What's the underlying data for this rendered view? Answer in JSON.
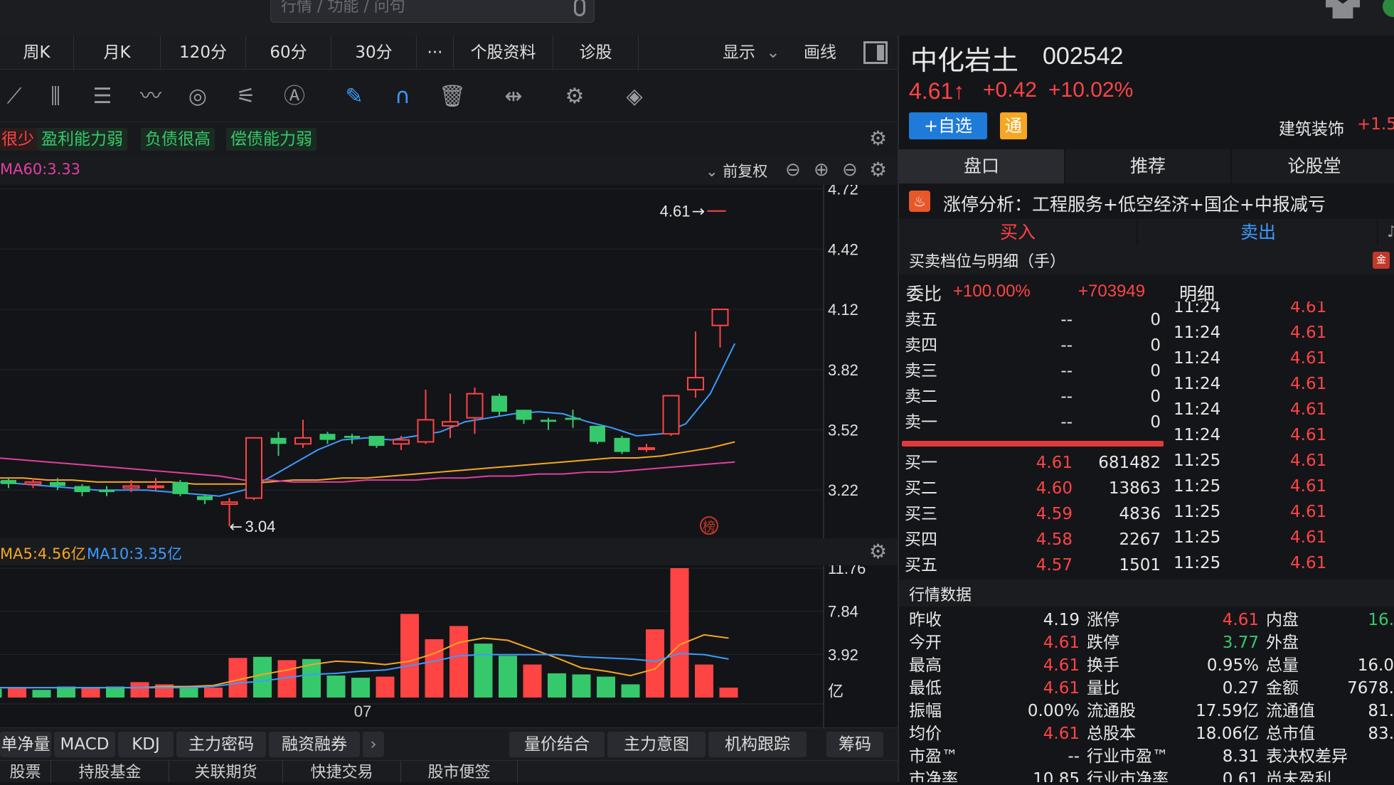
{
  "search": {
    "placeholder": "行情 / 功能 / 问句"
  },
  "period_tabs": [
    {
      "label": "周K"
    },
    {
      "label": "月K"
    },
    {
      "label": "120分"
    },
    {
      "label": "60分"
    },
    {
      "label": "30分"
    },
    {
      "label": "···"
    },
    {
      "label": "个股资料"
    },
    {
      "label": "诊股"
    }
  ],
  "display": {
    "show_label": "显示",
    "draw_label": "画线"
  },
  "tags": [
    {
      "label": "很少",
      "color": "#ff4444"
    },
    {
      "label": "盈利能力弱"
    },
    {
      "label": "负债很高"
    },
    {
      "label": "偿债能力弱"
    }
  ],
  "ma_bar": {
    "ma60": "MA60:3.33",
    "adj": "前复权"
  },
  "price_axis": {
    "ticks": [
      "4.72",
      "4.42",
      "4.12",
      "3.82",
      "3.52",
      "3.22"
    ]
  },
  "price_labels": {
    "high": "4.61",
    "low": "3.04",
    "bang": "榜"
  },
  "vol_header": {
    "ma5": "MA5:4.56亿",
    "ma10": "MA10:3.35亿"
  },
  "vol_axis": {
    "ticks": [
      "11.76",
      "7.84",
      "3.92",
      "亿"
    ]
  },
  "x_label": "07",
  "indicator_tabs": [
    {
      "label": "单净量"
    },
    {
      "label": "MACD"
    },
    {
      "label": "KDJ"
    },
    {
      "label": "主力密码"
    },
    {
      "label": "融资融券"
    }
  ],
  "analysis_tabs": [
    {
      "label": "量价结合"
    },
    {
      "label": "主力意图"
    },
    {
      "label": "机构跟踪"
    }
  ],
  "chip_label": "筹码",
  "bottom_tabs": [
    {
      "label": "股票"
    },
    {
      "label": "持股基金"
    },
    {
      "label": "关联期货"
    },
    {
      "label": "快捷交易"
    },
    {
      "label": "股市便签"
    }
  ],
  "stock": {
    "name": "中化岩土",
    "code": "002542",
    "price": "4.61↑",
    "change": "+0.42",
    "change_pct": "+10.02%",
    "add_btn": "+自选",
    "tong": "通",
    "sector": "建筑装饰",
    "sector_change": "+1.5"
  },
  "right_tabs": [
    {
      "label": "盘口"
    },
    {
      "label": "推荐"
    },
    {
      "label": "论股堂"
    }
  ],
  "limit_up": {
    "text": "涨停分析：工程服务+低空经济+国企+中报减亏"
  },
  "buy_sell": {
    "buy": "买入",
    "sell": "卖出",
    "extra": "♪"
  },
  "orderbook": {
    "title": "买卖档位与明细（手）",
    "webi_label": "委比",
    "webi": "+100.00%",
    "weicha": "+703949",
    "mingxi": "明细",
    "sell": [
      {
        "label": "卖五",
        "price": "--",
        "vol": "0"
      },
      {
        "label": "卖四",
        "price": "--",
        "vol": "0"
      },
      {
        "label": "卖三",
        "price": "--",
        "vol": "0"
      },
      {
        "label": "卖二",
        "price": "--",
        "vol": "0"
      },
      {
        "label": "卖一",
        "price": "--",
        "vol": "0"
      }
    ],
    "buy": [
      {
        "label": "买一",
        "price": "4.61",
        "vol": "681482"
      },
      {
        "label": "买二",
        "price": "4.60",
        "vol": "13863"
      },
      {
        "label": "买三",
        "price": "4.59",
        "vol": "4836"
      },
      {
        "label": "买四",
        "price": "4.58",
        "vol": "2267"
      },
      {
        "label": "买五",
        "price": "4.57",
        "vol": "1501"
      }
    ]
  },
  "ticks": [
    {
      "time": "11:24",
      "price": "4.61"
    },
    {
      "time": "11:24",
      "price": "4.61"
    },
    {
      "time": "11:24",
      "price": "4.61"
    },
    {
      "time": "11:24",
      "price": "4.61"
    },
    {
      "time": "11:24",
      "price": "4.61"
    },
    {
      "time": "11:24",
      "price": "4.61"
    },
    {
      "time": "11:25",
      "price": "4.61"
    },
    {
      "time": "11:25",
      "price": "4.61"
    },
    {
      "time": "11:25",
      "price": "4.61"
    },
    {
      "time": "11:25",
      "price": "4.61"
    },
    {
      "time": "11:25",
      "price": "4.61"
    }
  ],
  "market": {
    "title": "行情数据",
    "rows": [
      {
        "l1": "昨收",
        "v1": "4.19",
        "c1": "#e8e8e8",
        "l2": "涨停",
        "v2": "4.61",
        "c2": "#ff4444",
        "l3": "内盘",
        "v3": "16.",
        "c3": "#35c96b"
      },
      {
        "l1": "今开",
        "v1": "4.61",
        "c1": "#ff4444",
        "l2": "跌停",
        "v2": "3.77",
        "c2": "#35c96b",
        "l3": "外盘",
        "v3": "",
        "c3": "#ff4444"
      },
      {
        "l1": "最高",
        "v1": "4.61",
        "c1": "#ff4444",
        "l2": "换手",
        "v2": "0.95%",
        "c2": "#e8e8e8",
        "l3": "总量",
        "v3": "16.0",
        "c3": "#e8e8e8"
      },
      {
        "l1": "最低",
        "v1": "4.61",
        "c1": "#ff4444",
        "l2": "量比",
        "v2": "0.27",
        "c2": "#e8e8e8",
        "l3": "金额",
        "v3": "7678.",
        "c3": "#e8e8e8"
      },
      {
        "l1": "振幅",
        "v1": "0.00%",
        "c1": "#e8e8e8",
        "l2": "流通股",
        "v2": "17.59亿",
        "c2": "#e8e8e8",
        "l3": "流通值",
        "v3": "81.",
        "c3": "#e8e8e8"
      },
      {
        "l1": "均价",
        "v1": "4.61",
        "c1": "#ff4444",
        "l2": "总股本",
        "v2": "18.06亿",
        "c2": "#e8e8e8",
        "l3": "总市值",
        "v3": "83.",
        "c3": "#e8e8e8"
      },
      {
        "l1": "市盈™",
        "v1": "--",
        "c1": "#e8e8e8",
        "l2": "行业市盈™",
        "v2": "8.31",
        "c2": "#e8e8e8",
        "l3": "表决权差异",
        "v3": "",
        "c3": "#e8e8e8"
      },
      {
        "l1": "市净率",
        "v1": "10.85",
        "c1": "#e8e8e8",
        "l2": "行业市净率",
        "v2": "0.61",
        "c2": "#e8e8e8",
        "l3": "尚未盈利",
        "v3": "",
        "c3": "#e8e8e8"
      }
    ]
  },
  "colors": {
    "up": "#ff4444",
    "down": "#35c96b",
    "ma5": "#ffffff",
    "ma10": "#3b9cff",
    "ma20": "#f5a623",
    "ma60": "#e040a0",
    "bg": "#131418"
  },
  "chart_data": {
    "type": "candlestick",
    "ylim": [
      2.98,
      4.74
    ],
    "candles": [
      {
        "o": 3.27,
        "c": 3.25,
        "h": 3.28,
        "l": 3.23
      },
      {
        "o": 3.25,
        "c": 3.26,
        "h": 3.28,
        "l": 3.23
      },
      {
        "o": 3.26,
        "c": 3.24,
        "h": 3.28,
        "l": 3.22
      },
      {
        "o": 3.24,
        "c": 3.21,
        "h": 3.25,
        "l": 3.19
      },
      {
        "o": 3.22,
        "c": 3.21,
        "h": 3.24,
        "l": 3.19
      },
      {
        "o": 3.23,
        "c": 3.24,
        "h": 3.27,
        "l": 3.21
      },
      {
        "o": 3.24,
        "c": 3.24,
        "h": 3.28,
        "l": 3.22
      },
      {
        "o": 3.26,
        "c": 3.2,
        "h": 3.27,
        "l": 3.19
      },
      {
        "o": 3.19,
        "c": 3.17,
        "h": 3.2,
        "l": 3.15
      },
      {
        "o": 3.15,
        "c": 3.16,
        "h": 3.18,
        "l": 3.04
      },
      {
        "o": 3.18,
        "c": 3.48,
        "h": 3.48,
        "l": 3.17
      },
      {
        "o": 3.48,
        "c": 3.45,
        "h": 3.51,
        "l": 3.39
      },
      {
        "o": 3.45,
        "c": 3.48,
        "h": 3.57,
        "l": 3.43
      },
      {
        "o": 3.5,
        "c": 3.47,
        "h": 3.51,
        "l": 3.45
      },
      {
        "o": 3.49,
        "c": 3.48,
        "h": 3.5,
        "l": 3.45
      },
      {
        "o": 3.49,
        "c": 3.44,
        "h": 3.49,
        "l": 3.43
      },
      {
        "o": 3.45,
        "c": 3.47,
        "h": 3.49,
        "l": 3.42
      },
      {
        "o": 3.46,
        "c": 3.57,
        "h": 3.72,
        "l": 3.45
      },
      {
        "o": 3.54,
        "c": 3.56,
        "h": 3.7,
        "l": 3.48
      },
      {
        "o": 3.58,
        "c": 3.7,
        "h": 3.73,
        "l": 3.5
      },
      {
        "o": 3.69,
        "c": 3.61,
        "h": 3.7,
        "l": 3.59
      },
      {
        "o": 3.62,
        "c": 3.57,
        "h": 3.62,
        "l": 3.55
      },
      {
        "o": 3.57,
        "c": 3.56,
        "h": 3.58,
        "l": 3.52
      },
      {
        "o": 3.58,
        "c": 3.57,
        "h": 3.62,
        "l": 3.53
      },
      {
        "o": 3.54,
        "c": 3.46,
        "h": 3.54,
        "l": 3.45
      },
      {
        "o": 3.48,
        "c": 3.41,
        "h": 3.49,
        "l": 3.4
      },
      {
        "o": 3.43,
        "c": 3.43,
        "h": 3.45,
        "l": 3.41
      },
      {
        "o": 3.5,
        "c": 3.69,
        "h": 3.69,
        "l": 3.49
      },
      {
        "o": 3.72,
        "c": 3.78,
        "h": 4.01,
        "l": 3.68
      },
      {
        "o": 4.04,
        "c": 4.12,
        "h": 4.12,
        "l": 3.93
      }
    ],
    "volume": [
      0.8,
      0.9,
      0.7,
      1.0,
      0.9,
      1.0,
      1.4,
      1.2,
      1.0,
      0.9,
      3.6,
      3.7,
      3.4,
      3.5,
      2.0,
      1.8,
      1.9,
      7.6,
      5.3,
      6.5,
      4.9,
      3.8,
      3.0,
      2.2,
      2.1,
      1.9,
      1.2,
      6.2,
      11.76,
      3.0,
      0.9
    ],
    "ylim_vol": [
      0,
      11.76
    ],
    "ma5": [
      3.26,
      3.25,
      3.24,
      3.23,
      3.22,
      3.22,
      3.22,
      3.21,
      3.2,
      3.19,
      3.22,
      3.28,
      3.35,
      3.42,
      3.47,
      3.48,
      3.47,
      3.49,
      3.51,
      3.56,
      3.58,
      3.6,
      3.61,
      3.6,
      3.56,
      3.53,
      3.49,
      3.5,
      3.55,
      3.7,
      3.95
    ],
    "ma10": [
      3.3,
      3.29,
      3.28,
      3.27,
      3.26,
      3.25,
      3.24,
      3.24,
      3.23,
      3.22,
      3.22,
      3.24,
      3.26,
      3.29,
      3.32,
      3.35,
      3.37,
      3.39,
      3.41,
      3.44,
      3.47,
      3.49,
      3.51,
      3.53,
      3.53,
      3.53,
      3.54,
      3.55,
      3.57,
      3.6,
      3.63
    ],
    "ma20": [
      3.28,
      3.28,
      3.27,
      3.27,
      3.26,
      3.26,
      3.26,
      3.26,
      3.25,
      3.25,
      3.25,
      3.26,
      3.27,
      3.27,
      3.28,
      3.28,
      3.29,
      3.3,
      3.31,
      3.32,
      3.33,
      3.34,
      3.35,
      3.36,
      3.37,
      3.38,
      3.38,
      3.39,
      3.41,
      3.43,
      3.46
    ],
    "ma60": [
      3.38,
      3.37,
      3.36,
      3.35,
      3.34,
      3.33,
      3.32,
      3.31,
      3.3,
      3.29,
      3.27,
      3.27,
      3.26,
      3.26,
      3.26,
      3.27,
      3.27,
      3.27,
      3.28,
      3.28,
      3.29,
      3.29,
      3.3,
      3.3,
      3.31,
      3.31,
      3.32,
      3.33,
      3.34,
      3.35,
      3.36
    ],
    "vol_ma5": [
      0.9,
      0.9,
      0.9,
      0.9,
      0.9,
      0.9,
      0.9,
      1.0,
      1.0,
      1.1,
      1.6,
      2.1,
      2.5,
      3.0,
      3.3,
      3.2,
      3.0,
      3.3,
      4.0,
      5.0,
      5.4,
      5.2,
      4.4,
      3.6,
      2.7,
      2.4,
      2.0,
      2.6,
      4.8,
      5.7,
      5.4
    ],
    "vol_ma10": [
      0.9,
      0.9,
      0.9,
      0.9,
      0.9,
      0.9,
      0.9,
      0.9,
      0.9,
      1.0,
      1.3,
      1.5,
      1.8,
      2.1,
      2.2,
      2.4,
      2.5,
      2.9,
      3.3,
      3.8,
      3.9,
      3.9,
      3.9,
      3.9,
      3.7,
      3.6,
      3.5,
      3.3,
      4.0,
      3.9,
      3.5
    ],
    "vol_colors": [
      "d",
      "u",
      "d",
      "d",
      "u",
      "d",
      "u",
      "u",
      "d",
      "u",
      "u",
      "d",
      "u",
      "d",
      "d",
      "d",
      "u",
      "u",
      "u",
      "u",
      "d",
      "d",
      "u",
      "d",
      "d",
      "d",
      "d",
      "u",
      "u",
      "u",
      "u"
    ]
  }
}
